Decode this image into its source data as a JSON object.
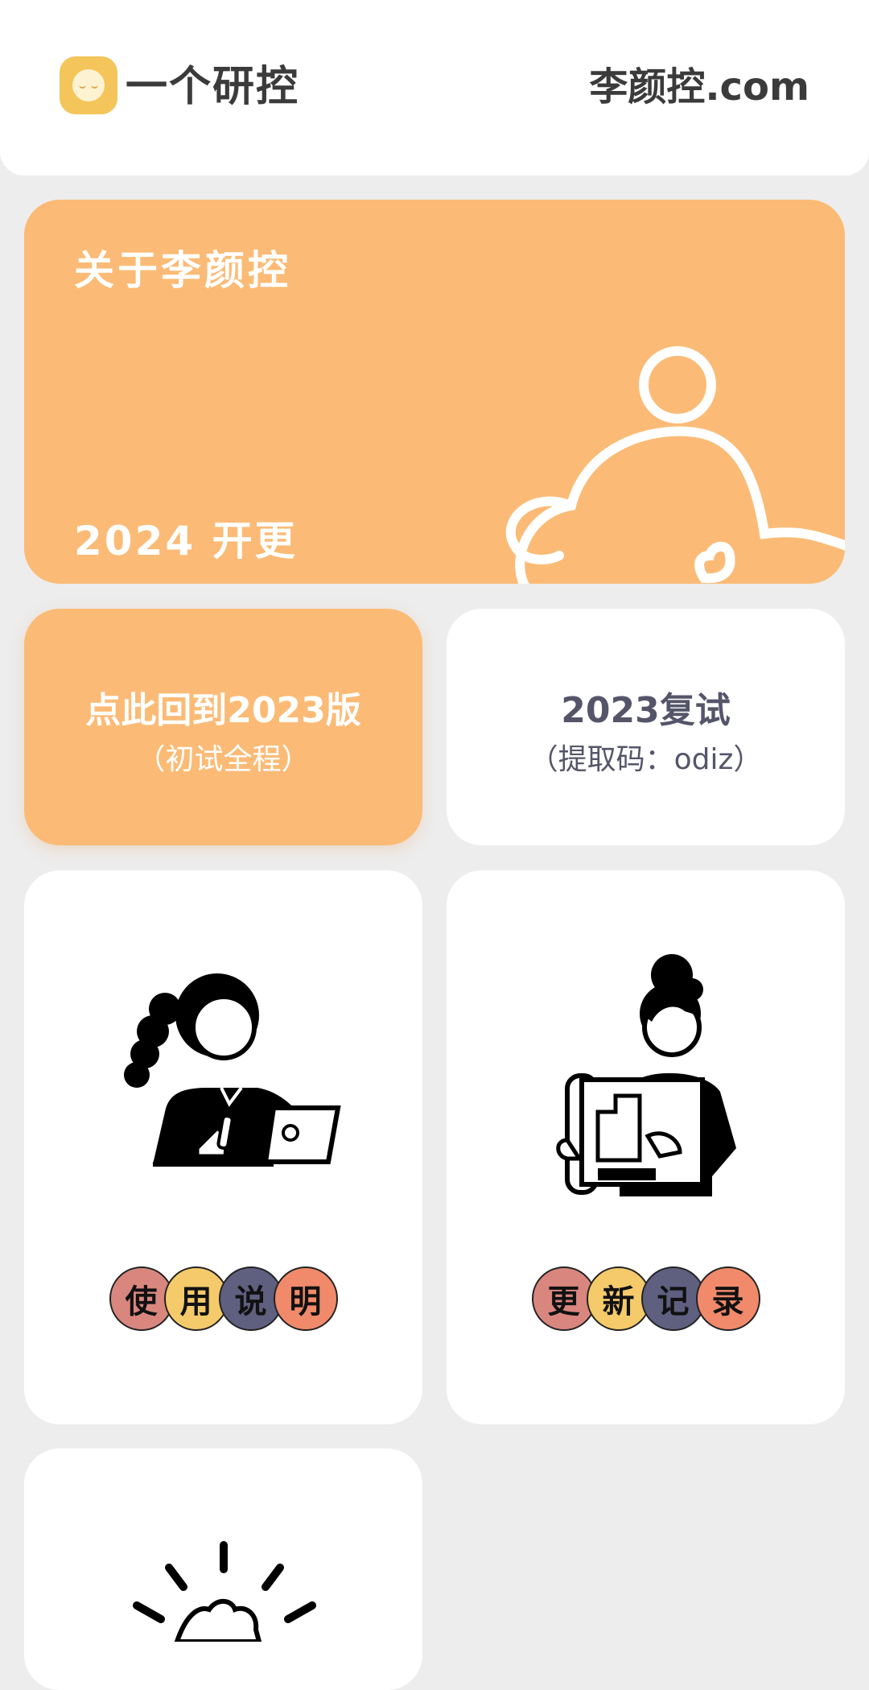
{
  "header": {
    "logo_text": "一个研控",
    "site_text": "李颜控.com"
  },
  "hero": {
    "title": "关于李颜控",
    "subtitle": "2024 开更"
  },
  "buttons": {
    "v2023": {
      "line1": "点此回到2023版",
      "line2": "（初试全程）"
    },
    "retest": {
      "line1": "2023复试",
      "line2": "（提取码：odiz）"
    }
  },
  "cards": {
    "guide": {
      "chars": [
        "使",
        "用",
        "说",
        "明"
      ]
    },
    "changelog": {
      "chars": [
        "更",
        "新",
        "记",
        "录"
      ]
    }
  },
  "colors": {
    "accent_orange": "#fbbb76",
    "badge_colors": [
      "#d9867e",
      "#f4ca6a",
      "#5f5f80",
      "#f08a6a"
    ],
    "background": "#ededed"
  },
  "icons": {
    "logo": "sun-face-icon",
    "hero": "bear-outline-icon",
    "guide": "student-laptop-illustration",
    "changelog": "woman-blueprint-illustration",
    "third": "fist-celebrate-illustration"
  }
}
